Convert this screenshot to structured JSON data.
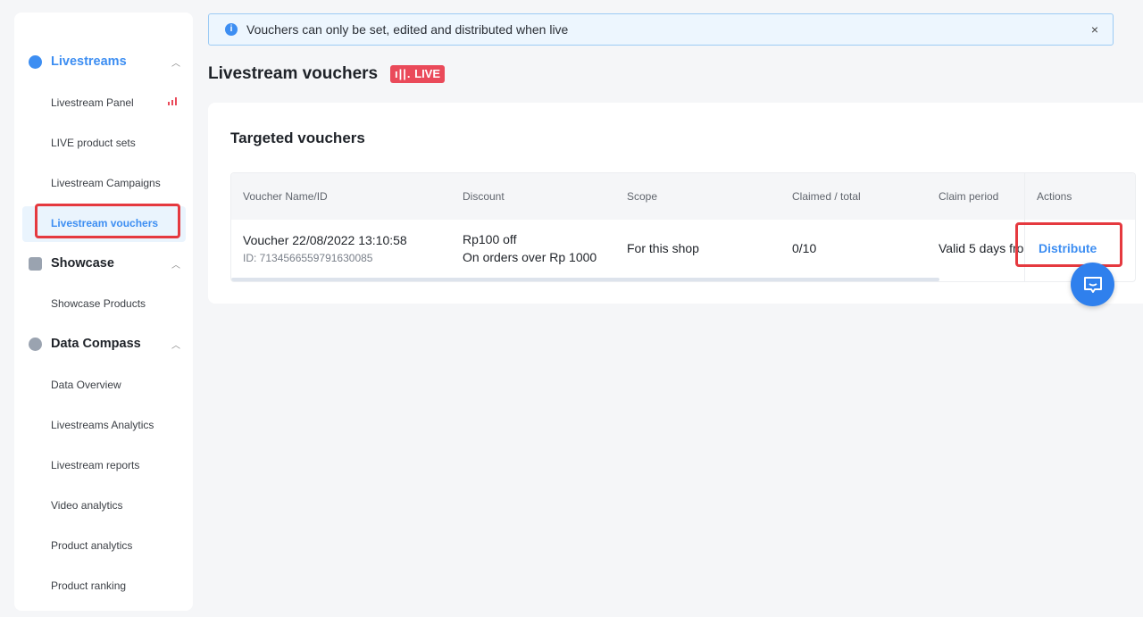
{
  "sidebar": {
    "groups": [
      {
        "label": "Livestreams",
        "items": [
          "Livestream Panel",
          "LIVE product sets",
          "Livestream Campaigns",
          "Livestream vouchers"
        ]
      },
      {
        "label": "Showcase",
        "items": [
          "Showcase Products"
        ]
      },
      {
        "label": "Data Compass",
        "items": [
          "Data Overview",
          "Livestreams Analytics",
          "Livestream reports",
          "Video analytics",
          "Product analytics",
          "Product ranking"
        ]
      }
    ],
    "active_item": "Livestream vouchers"
  },
  "banner": {
    "text": "Vouchers can only be set, edited and distributed when live",
    "close": "×"
  },
  "page": {
    "title": "Livestream vouchers",
    "live_badge": "LIVE"
  },
  "card": {
    "title": "Targeted vouchers"
  },
  "table": {
    "headers": [
      "Voucher Name/ID",
      "Discount",
      "Scope",
      "Claimed / total",
      "Claim period",
      "Actions"
    ],
    "rows": [
      {
        "name": "Voucher 22/08/2022 13:10:58",
        "id": "ID: 7134566559791630085",
        "discount_1": "Rp100 off",
        "discount_2": "On orders over Rp 1000",
        "scope": "For this shop",
        "claimed": "0/10",
        "period": "Valid 5 days fro",
        "action": "Distribute"
      }
    ]
  },
  "colors": {
    "accent": "#2f80ed",
    "live": "#ea4a5a",
    "highlight": "#e5393f"
  }
}
